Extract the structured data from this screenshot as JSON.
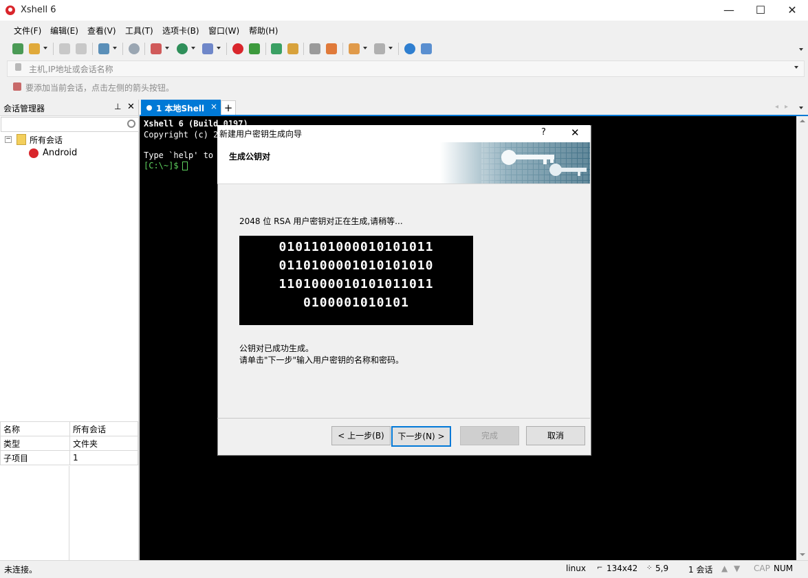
{
  "window": {
    "title": "Xshell 6",
    "minimize": "—",
    "maximize": "☐",
    "close": "✕"
  },
  "menu": [
    "文件(F)",
    "编辑(E)",
    "查看(V)",
    "工具(T)",
    "选项卡(B)",
    "窗口(W)",
    "帮助(H)"
  ],
  "address": {
    "placeholder": "主机,IP地址或会话名称"
  },
  "hint": "要添加当前会话，点击左侧的箭头按钮。",
  "session_manager": {
    "title": "会话管理器",
    "tree_root": "所有会话",
    "tree_child": "Android",
    "properties": [
      {
        "name": "名称",
        "value": "所有会话"
      },
      {
        "name": "类型",
        "value": "文件夹"
      },
      {
        "name": "子项目",
        "value": "1"
      }
    ]
  },
  "tab": {
    "label": "1 本地Shell",
    "close": "×",
    "add": "+"
  },
  "terminal": {
    "line1": "Xshell 6 (Build 0197)",
    "line2": "Copyright (c) 2",
    "line3": "Type `help' to l",
    "prompt": "[C:\\~]$ "
  },
  "dialog": {
    "title": "新建用户密钥生成向导",
    "help": "?",
    "close": "✕",
    "header": "生成公钥对",
    "progress": "2048 位 RSA 用户密钥对正在生成,请稍等...",
    "binary": [
      "0101101000010101011",
      "0110100001010101010",
      "1101000010101011011",
      "0100001010101"
    ],
    "done_line1": "公钥对已成功生成。",
    "done_line2": "请单击\"下一步\"输入用户密钥的名称和密码。",
    "buttons": {
      "back": "< 上一步(B)",
      "next": "下一步(N) >",
      "finish": "完成",
      "cancel": "取消"
    }
  },
  "status": {
    "connection": "未连接。",
    "os": "linux",
    "size": "134x42",
    "cursor": "5,9",
    "sessions": "1 会话",
    "cap": "CAP",
    "num": "NUM"
  }
}
